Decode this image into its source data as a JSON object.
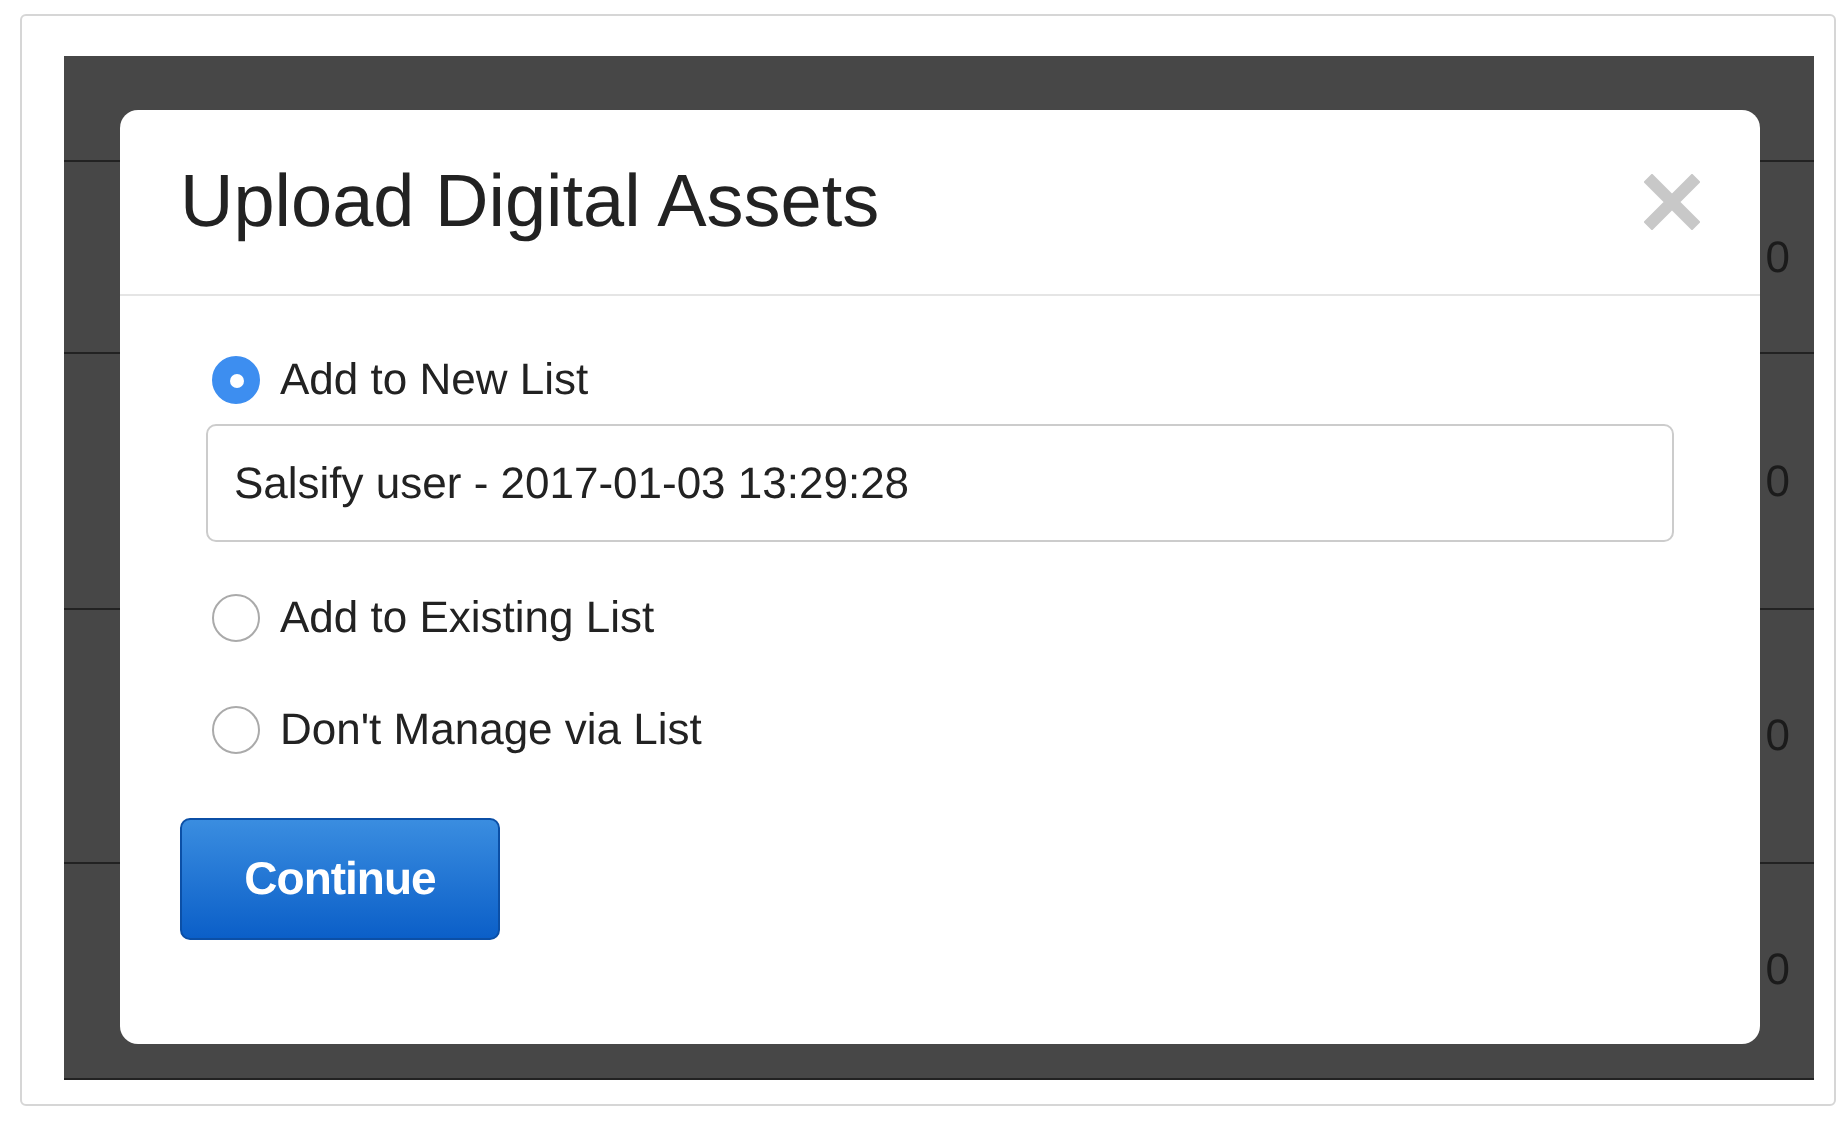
{
  "background_table": {
    "rows": [
      {
        "value": "0"
      },
      {
        "value": "0"
      },
      {
        "value": "0"
      },
      {
        "value": "0"
      }
    ]
  },
  "modal": {
    "title": "Upload Digital Assets",
    "options": [
      {
        "label": "Add to New List",
        "selected": true,
        "kind": "with_field",
        "field_value": "Salsify user - 2017-01-03 13:29:28"
      },
      {
        "label": "Add to Existing List",
        "selected": false,
        "kind": "plain"
      },
      {
        "label": "Don't Manage via List",
        "selected": false,
        "kind": "plain"
      }
    ],
    "button": "Continue"
  }
}
